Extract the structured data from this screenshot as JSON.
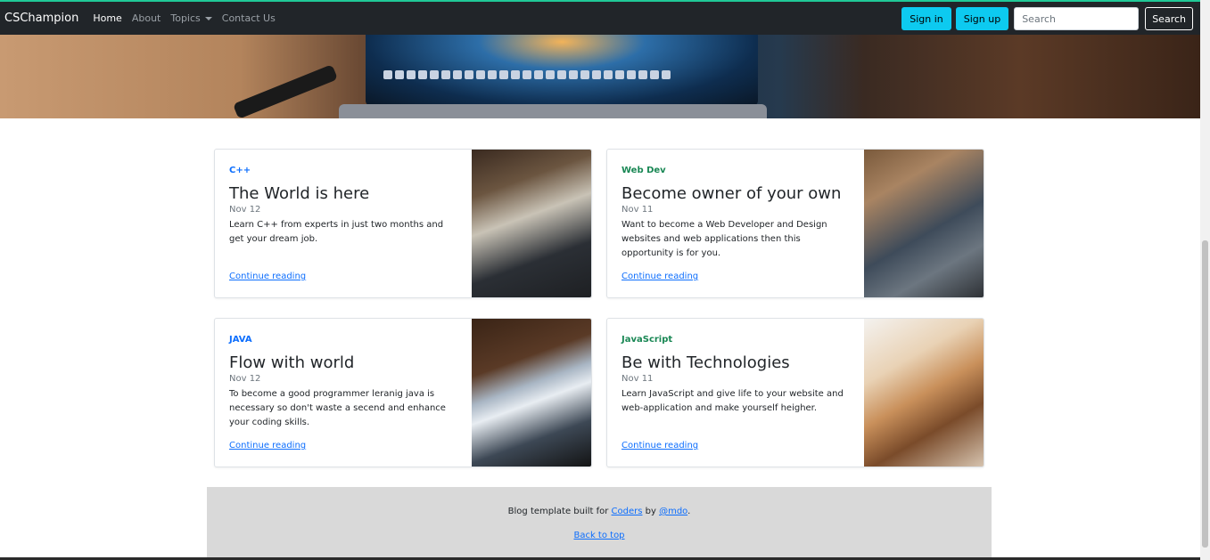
{
  "navbar": {
    "brand": "CSChampion",
    "links": [
      "Home",
      "About",
      "Topics",
      "Contact Us"
    ],
    "signin": "Sign in",
    "signup": "Sign up",
    "search_placeholder": "Search",
    "search_button": "Search"
  },
  "posts": [
    {
      "category": "C++",
      "title": "The World is here",
      "date": "Nov 12",
      "text": "Learn C++ from experts in just two months and get your dream job.",
      "link": "Continue reading"
    },
    {
      "category": "Web Dev",
      "title": "Become owner of your own",
      "date": "Nov 11",
      "text": "Want to become a Web Developer and Design websites and web applications then this opportunity is for you.",
      "link": "Continue reading"
    },
    {
      "category": "JAVA",
      "title": "Flow with world",
      "date": "Nov 12",
      "text": "To become a good programmer leranig java is necessary so don't waste a secend and enhance your coding skills.",
      "link": "Continue reading"
    },
    {
      "category": "JavaScript",
      "title": "Be with Technologies",
      "date": "Nov 11",
      "text": "Learn JavaScript and give life to your website and web-application and make yourself heigher.",
      "link": "Continue reading"
    }
  ],
  "footer": {
    "prefix": "Blog template built for ",
    "coders": "Coders",
    "by": " by ",
    "author": "@mdo",
    "suffix": ".",
    "back_to_top": "Back to top"
  },
  "colors": {
    "navbar_bg": "#212529",
    "accent_info": "#0dcaf0",
    "category_primary": "#0d6efd",
    "category_success": "#198754",
    "footer_bg": "#d9d9d9"
  }
}
